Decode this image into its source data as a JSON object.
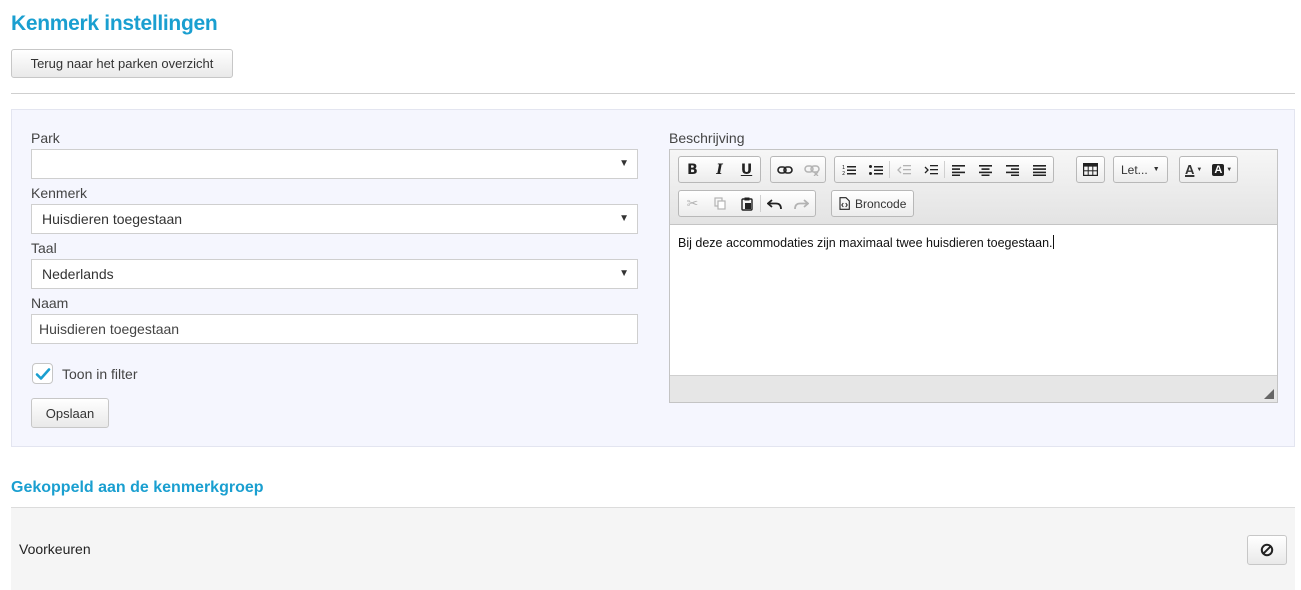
{
  "page": {
    "title": "Kenmerk instellingen"
  },
  "toolbar": {
    "back_label": "Terug naar het parken overzicht"
  },
  "form": {
    "park": {
      "label": "Park",
      "value": ""
    },
    "kenmerk": {
      "label": "Kenmerk",
      "value": "Huisdieren toegestaan"
    },
    "taal": {
      "label": "Taal",
      "value": "Nederlands"
    },
    "naam": {
      "label": "Naam",
      "value": "Huisdieren toegestaan"
    },
    "toon_in_filter": {
      "label": "Toon in filter",
      "checked": true
    },
    "save_label": "Opslaan"
  },
  "editor": {
    "label": "Beschrijving",
    "font_dropdown_label": "Let...",
    "source_label": "Broncode",
    "content": "Bij deze accommodaties zijn maximaal twee huisdieren toegestaan."
  },
  "linked_group": {
    "section_title": "Gekoppeld aan de kenmerkgroep",
    "items": [
      {
        "name": "Voorkeuren"
      }
    ]
  },
  "colors": {
    "accent": "#1a9fd0",
    "panel_bg": "#f5f6fe",
    "check": "#1a9fd0"
  }
}
